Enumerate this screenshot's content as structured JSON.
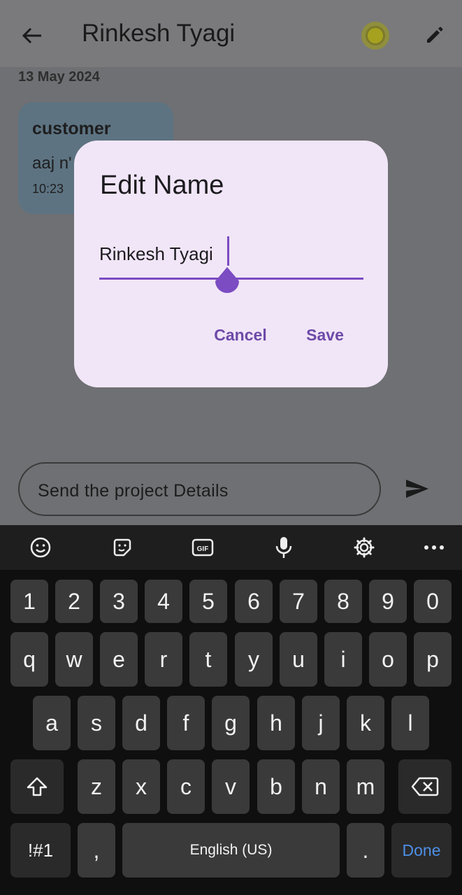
{
  "header": {
    "title": "Rinkesh Tyagi"
  },
  "chat": {
    "date": "13 May 2024",
    "message": {
      "sender": "customer",
      "text": "aaj n'",
      "time": "10:23"
    }
  },
  "dialog": {
    "title": "Edit Name",
    "input_value": "Rinkesh Tyagi",
    "cancel_label": "Cancel",
    "save_label": "Save"
  },
  "composer": {
    "placeholder": "Send the project Details"
  },
  "keyboard": {
    "numbers": [
      "1",
      "2",
      "3",
      "4",
      "5",
      "6",
      "7",
      "8",
      "9",
      "0"
    ],
    "row1": [
      "q",
      "w",
      "e",
      "r",
      "t",
      "y",
      "u",
      "i",
      "o",
      "p"
    ],
    "row2": [
      "a",
      "s",
      "d",
      "f",
      "g",
      "h",
      "j",
      "k",
      "l"
    ],
    "row3": [
      "z",
      "x",
      "c",
      "v",
      "b",
      "n",
      "m"
    ],
    "symbols_label": "!#1",
    "comma_label": ",",
    "space_label": "English (US)",
    "period_label": ".",
    "done_label": "Done"
  },
  "colors": {
    "accent": "#7b4cc2",
    "dialog_bg": "#f1e6f7",
    "done_blue": "#4d8fe6"
  }
}
